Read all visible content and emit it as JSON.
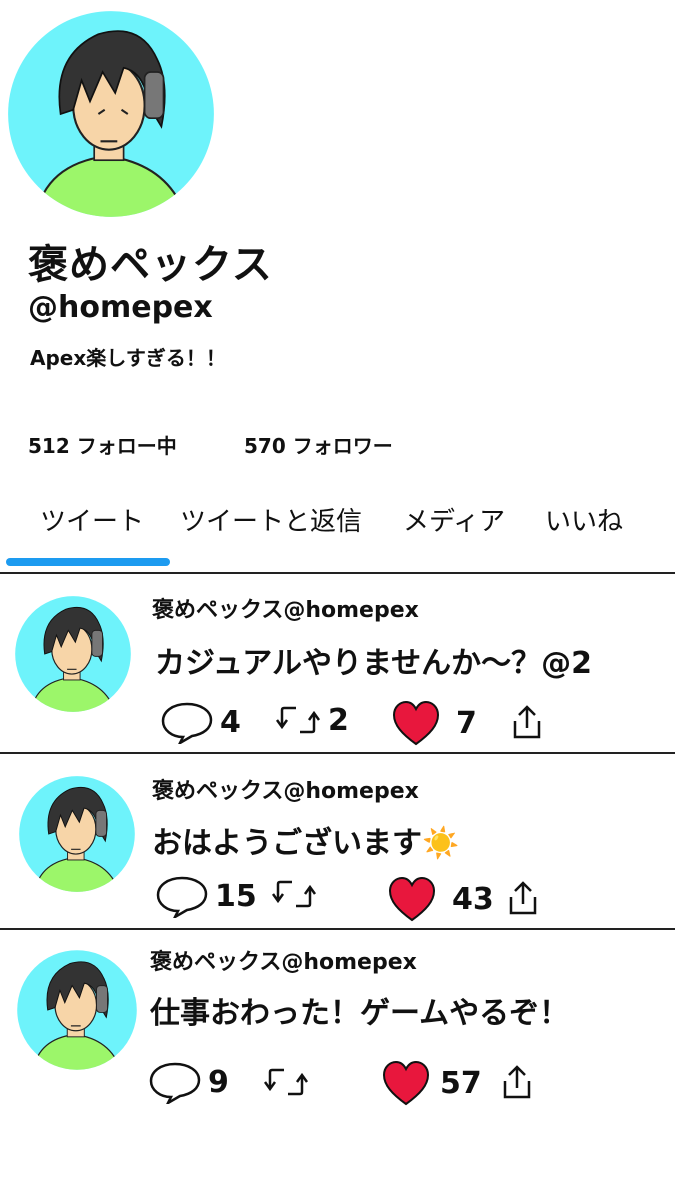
{
  "profile": {
    "display_name": "褒めペックス",
    "handle": "@homepex",
    "bio": "Apex楽しすぎる！！",
    "following_label": "512 フォロー中",
    "followers_label": "570 フォロワー",
    "avatar_colors": {
      "background": "#6ef3fb",
      "shirt": "#9cf66a",
      "hair": "#333333",
      "skin": "#f7d5a8"
    }
  },
  "tabs": [
    {
      "label": "ツイート",
      "active": true
    },
    {
      "label": "ツイートと返信",
      "active": false
    },
    {
      "label": "メディア",
      "active": false
    },
    {
      "label": "いいね",
      "active": false
    }
  ],
  "accent_color": "#1d9bf0",
  "like_color": "#e8173d",
  "tweets": [
    {
      "author": "褒めペックス@homepex",
      "text": "カジュアルやりませんか〜？@2",
      "replies": "4",
      "retweets": "2",
      "likes": "7"
    },
    {
      "author": "褒めペックス@homepex",
      "text": "おはようございます☀️",
      "replies": "15",
      "retweets": "",
      "likes": "43"
    },
    {
      "author": "褒めペックス@homepex",
      "text": "仕事おわった！ゲームやるぞ！",
      "replies": "9",
      "retweets": "",
      "likes": "57"
    }
  ],
  "icons": [
    "reply-icon",
    "retweet-icon",
    "heart-icon",
    "share-icon"
  ]
}
